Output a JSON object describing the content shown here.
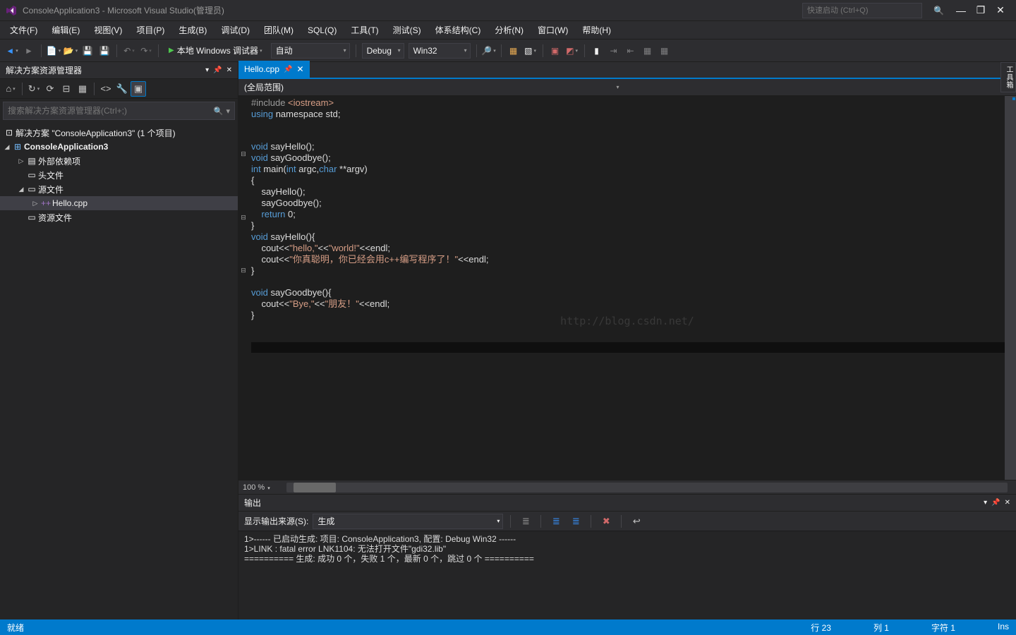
{
  "title": "ConsoleApplication3 - Microsoft Visual Studio(管理员)",
  "quick_launch_placeholder": "快速启动 (Ctrl+Q)",
  "menu": [
    "文件(F)",
    "编辑(E)",
    "视图(V)",
    "项目(P)",
    "生成(B)",
    "调试(D)",
    "团队(M)",
    "SQL(Q)",
    "工具(T)",
    "测试(S)",
    "体系结构(C)",
    "分析(N)",
    "窗口(W)",
    "帮助(H)"
  ],
  "toolbar": {
    "start_label": "本地 Windows 调试器",
    "config_auto": "自动",
    "config_debug": "Debug",
    "config_platform": "Win32"
  },
  "solution_explorer": {
    "title": "解决方案资源管理器",
    "search_placeholder": "搜索解决方案资源管理器(Ctrl+;)",
    "solution": "解决方案 \"ConsoleApplication3\" (1 个项目)",
    "project": "ConsoleApplication3",
    "nodes": {
      "external": "外部依赖项",
      "headers": "头文件",
      "sources": "源文件",
      "hello": "Hello.cpp",
      "resources": "资源文件"
    }
  },
  "editor": {
    "tab_label": "Hello.cpp",
    "scope": "(全局范围)",
    "zoom": "100 %",
    "watermark": "http://blog.csdn.net/"
  },
  "code": {
    "l1_a": "#include ",
    "l1_b": "<iostream>",
    "l2_a": "using",
    "l2_b": " namespace ",
    "l2_c": "std;",
    "l4_a": "void",
    "l4_b": " sayHello();",
    "l5_a": "void",
    "l5_b": " sayGoodbye();",
    "l6_a": "int",
    "l6_b": " main(",
    "l6_c": "int",
    "l6_d": " argc,",
    "l6_e": "char",
    "l6_f": " **argv)",
    "l7": "{",
    "l8": "    sayHello();",
    "l9": "    sayGoodbye();",
    "l10_a": "    ",
    "l10_b": "return",
    "l10_c": " 0;",
    "l11": "}",
    "l12_a": "void",
    "l12_b": " sayHello(){",
    "l13_a": "    cout<<",
    "l13_b": "\"hello,\"",
    "l13_c": "<<",
    "l13_d": "\"world!\"",
    "l13_e": "<<endl;",
    "l14_a": "    cout<<",
    "l14_b": "\"你真聪明，你已经会用c++编写程序了！\"",
    "l14_c": "<<endl;",
    "l15": "}",
    "l17_a": "void",
    "l17_b": " sayGoodbye(){",
    "l18_a": "    cout<<",
    "l18_b": "\"Bye,\"",
    "l18_c": "<<",
    "l18_d": "\"朋友！\"",
    "l18_e": "<<endl;",
    "l19": "}"
  },
  "output": {
    "title": "输出",
    "source_label": "显示输出来源(S):",
    "source_value": "生成",
    "line1": "1>------ 已启动生成: 项目: ConsoleApplication3, 配置: Debug Win32 ------",
    "line2": "1>LINK : fatal error LNK1104: 无法打开文件\"gdi32.lib\"",
    "line3": "========== 生成: 成功 0 个，失败 1 个，最新 0 个，跳过 0 个 =========="
  },
  "statusbar": {
    "ready": "就绪",
    "line": "行 23",
    "col": "列 1",
    "char": "字符 1",
    "ins": "Ins"
  },
  "right_dock": "工具箱"
}
